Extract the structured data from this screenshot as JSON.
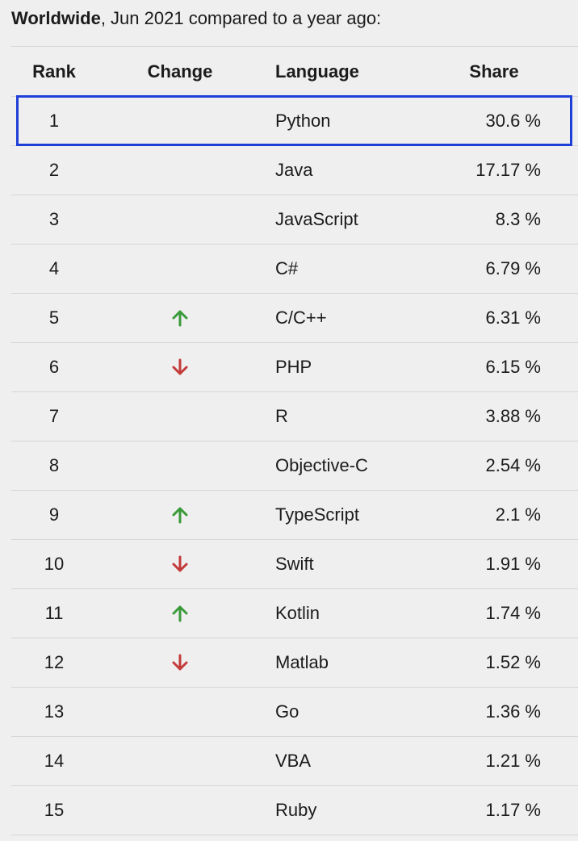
{
  "heading": {
    "strong": "Worldwide",
    "rest": ", Jun 2021 compared to a year ago:"
  },
  "columns": {
    "rank": "Rank",
    "change": "Change",
    "language": "Language",
    "share": "Share"
  },
  "colors": {
    "up": "#3a9a3a",
    "down": "#c43a3a",
    "highlight": "#1f3fd9"
  },
  "rows": [
    {
      "rank": "1",
      "change": "",
      "language": "Python",
      "share": "30.6 %"
    },
    {
      "rank": "2",
      "change": "",
      "language": "Java",
      "share": "17.17 %"
    },
    {
      "rank": "3",
      "change": "",
      "language": "JavaScript",
      "share": "8.3 %"
    },
    {
      "rank": "4",
      "change": "",
      "language": "C#",
      "share": "6.79 %"
    },
    {
      "rank": "5",
      "change": "up",
      "language": "C/C++",
      "share": "6.31 %"
    },
    {
      "rank": "6",
      "change": "down",
      "language": "PHP",
      "share": "6.15 %"
    },
    {
      "rank": "7",
      "change": "",
      "language": "R",
      "share": "3.88 %"
    },
    {
      "rank": "8",
      "change": "",
      "language": "Objective-C",
      "share": "2.54 %"
    },
    {
      "rank": "9",
      "change": "up",
      "language": "TypeScript",
      "share": "2.1 %"
    },
    {
      "rank": "10",
      "change": "down",
      "language": "Swift",
      "share": "1.91 %"
    },
    {
      "rank": "11",
      "change": "up",
      "language": "Kotlin",
      "share": "1.74 %"
    },
    {
      "rank": "12",
      "change": "down",
      "language": "Matlab",
      "share": "1.52 %"
    },
    {
      "rank": "13",
      "change": "",
      "language": "Go",
      "share": "1.36 %"
    },
    {
      "rank": "14",
      "change": "",
      "language": "VBA",
      "share": "1.21 %"
    },
    {
      "rank": "15",
      "change": "",
      "language": "Ruby",
      "share": "1.17 %"
    }
  ]
}
